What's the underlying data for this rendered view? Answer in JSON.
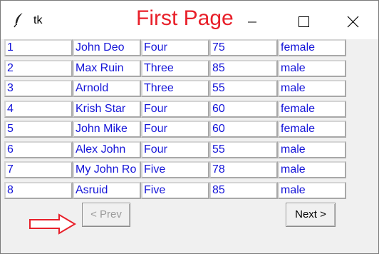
{
  "window": {
    "app_title": "tk",
    "page_title": "First Page",
    "icons": {
      "app": "feather-icon",
      "minimize": "minimize-icon",
      "maximize": "maximize-icon",
      "close": "close-icon"
    }
  },
  "table": {
    "rows": [
      [
        "1",
        "John Deo",
        "Four",
        "75",
        "female"
      ],
      [
        "2",
        "Max Ruin",
        "Three",
        "85",
        "male"
      ],
      [
        "3",
        "Arnold",
        "Three",
        "55",
        "male"
      ],
      [
        "4",
        "Krish Star",
        "Four",
        "60",
        "female"
      ],
      [
        "5",
        "John Mike",
        "Four",
        "60",
        "female"
      ],
      [
        "6",
        "Alex John",
        "Four",
        "55",
        "male"
      ],
      [
        "7",
        "My John Ro",
        "Five",
        "78",
        "male"
      ],
      [
        "8",
        "Asruid",
        "Five",
        "85",
        "male"
      ]
    ]
  },
  "nav": {
    "prev_label": "< Prev",
    "next_label": "Next >",
    "prev_disabled": true
  },
  "annotation": {
    "icon": "right-arrow-icon",
    "color": "#e8202a"
  },
  "colors": {
    "cell_text": "#1515d8",
    "title_accent": "#e8202a"
  }
}
